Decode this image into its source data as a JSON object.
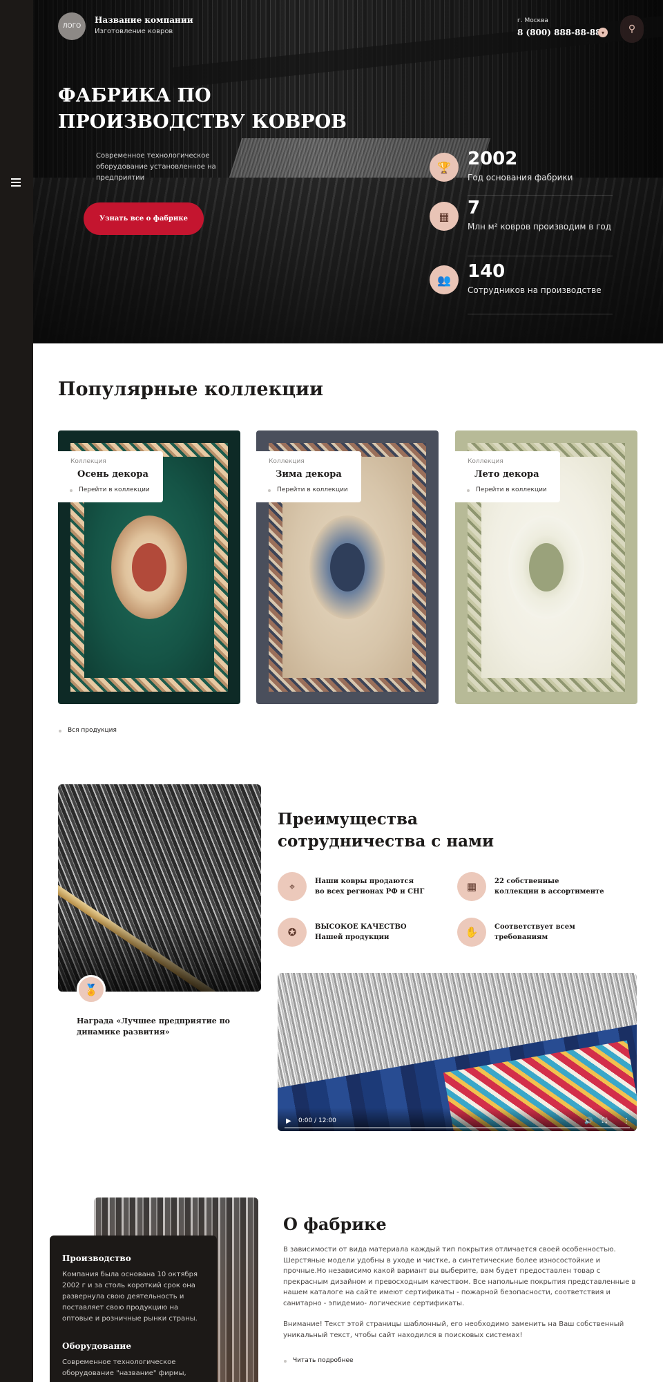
{
  "header": {
    "logo_text": "ЛОГО",
    "company_name": "Название компании",
    "company_sub": "Изготовление ковров",
    "city": "г. Москва",
    "phone": "8 (800) 888-88-88",
    "phone_dropdown_icon": "chevron-down-icon",
    "share_icon": "share-icon",
    "menu_icon": "hamburger-icon"
  },
  "hero": {
    "title": "ФАБРИКА ПО ПРОИЗВОДСТВУ КОВРОВ",
    "description": "Современное технологическое оборудование установленное на предприятии",
    "button": "Узнать все о фабрике",
    "stats": [
      {
        "icon": "trophy-icon",
        "value": "2002",
        "label": "Год основания фабрики"
      },
      {
        "icon": "loom-icon",
        "value": "7",
        "label": "Млн м² ковров производим в год"
      },
      {
        "icon": "workers-icon",
        "value": "140",
        "label": "Сотрудников на производстве"
      }
    ]
  },
  "collections": {
    "title": "Популярные коллекции",
    "items": [
      {
        "kicker": "Коллекция",
        "name": "Осень декора",
        "link": "Перейти в коллекции"
      },
      {
        "kicker": "Коллекция",
        "name": "Зима декора",
        "link": "Перейти в коллекции"
      },
      {
        "kicker": "Коллекция",
        "name": "Лето декора",
        "link": "Перейти в коллекции"
      }
    ],
    "all_link": "Вся продукция"
  },
  "advantages": {
    "title": "Преимущества сотрудничества с нами",
    "award_icon": "medal-icon",
    "award": "Награда «Лучшее предприятие по динамике развития»",
    "items": [
      {
        "icon": "map-pin-icon",
        "text": "Наши ковры продаются во всех регионах РФ и СНГ"
      },
      {
        "icon": "carpet-icon",
        "text": "22 собственные коллекции в ассортименте"
      },
      {
        "icon": "quality-icon",
        "text": "ВЫСОКОЕ КАЧЕСТВО Нашей продукции"
      },
      {
        "icon": "hand-check-icon",
        "text": "Соответствует всем требованиям"
      }
    ],
    "video": {
      "time": "0:00 / 12:00"
    }
  },
  "about": {
    "title": "О фабрике",
    "paragraph1": "В зависимости от вида материала каждый тип покрытия отличается своей особенностью. Шерстяные модели удобны в уходе и чистке, а синтетические более износостойкие и прочные.Но независимо какой вариант вы выберите, вам будет предоставлен товар с прекрасным дизайном и превосходным качеством. Все напольные покрытия представленные в нашем каталоге на сайте имеют сертификаты - пожарной безопасности, соответствия и санитарно - эпидемио- логические сертификаты.",
    "paragraph2": "Внимание! Текст этой страницы шаблонный, его необходимо заменить на Ваш собственный уникальный текст, чтобы сайт находился в поисковых системах!",
    "more_link": "Читать подробнее",
    "card": {
      "h1": "Производство",
      "p1": "Компания была основана 10 октября 2002 г и за столь короткий срок она развернула свою деятельность и поставляет свою продукцию на оптовые и розничные рынки страны.",
      "h2": "Оборудование",
      "p2": "Современное технологическое оборудование \"название\" фирмы, установленное на предприятии"
    }
  },
  "colors": {
    "accent_red": "#c4152f",
    "icon_pink": "#e9c4b6",
    "dark": "#1c1917"
  }
}
